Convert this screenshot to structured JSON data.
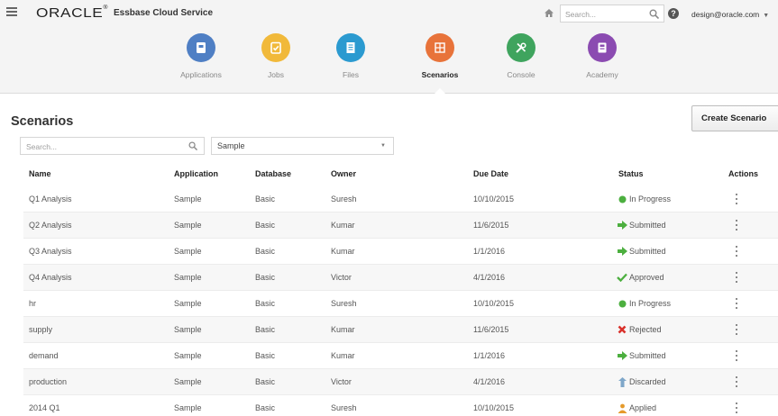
{
  "header": {
    "logo_text": "ORACLE",
    "logo_mark": "®",
    "service_title": "Essbase Cloud Service",
    "search_placeholder": "Search...",
    "user": "design@oracle.com",
    "help_label": "?"
  },
  "nav": {
    "items": [
      {
        "label": "Applications",
        "color": "#4f7fc4",
        "icon": "applications-icon"
      },
      {
        "label": "Jobs",
        "color": "#f1b93a",
        "icon": "jobs-icon"
      },
      {
        "label": "Files",
        "color": "#2b9ad0",
        "icon": "files-icon"
      },
      {
        "label": "Scenarios",
        "color": "#e8733a",
        "icon": "scenarios-icon",
        "active": true
      },
      {
        "label": "Console",
        "color": "#3fa45e",
        "icon": "console-icon"
      },
      {
        "label": "Academy",
        "color": "#8b4bb1",
        "icon": "academy-icon"
      }
    ]
  },
  "page": {
    "title": "Scenarios",
    "create_button": "Create Scenario",
    "search_placeholder": "Search...",
    "application_filter": "Sample"
  },
  "table": {
    "columns": [
      "Name",
      "Application",
      "Database",
      "Owner",
      "Due Date",
      "Status",
      "Actions"
    ],
    "rows": [
      {
        "name": "Q1 Analysis",
        "application": "Sample",
        "database": "Basic",
        "owner": "Suresh",
        "due": "10/10/2015",
        "status": "In Progress"
      },
      {
        "name": "Q2 Analysis",
        "application": "Sample",
        "database": "Basic",
        "owner": "Kumar",
        "due": "11/6/2015",
        "status": "Submitted"
      },
      {
        "name": "Q3 Analysis",
        "application": "Sample",
        "database": "Basic",
        "owner": "Kumar",
        "due": "1/1/2016",
        "status": "Submitted"
      },
      {
        "name": "Q4 Analysis",
        "application": "Sample",
        "database": "Basic",
        "owner": "Victor",
        "due": "4/1/2016",
        "status": "Approved"
      },
      {
        "name": "hr",
        "application": "Sample",
        "database": "Basic",
        "owner": "Suresh",
        "due": "10/10/2015",
        "status": "In Progress"
      },
      {
        "name": "supply",
        "application": "Sample",
        "database": "Basic",
        "owner": "Kumar",
        "due": "11/6/2015",
        "status": "Rejected"
      },
      {
        "name": "demand",
        "application": "Sample",
        "database": "Basic",
        "owner": "Kumar",
        "due": "1/1/2016",
        "status": "Submitted"
      },
      {
        "name": "production",
        "application": "Sample",
        "database": "Basic",
        "owner": "Victor",
        "due": "4/1/2016",
        "status": "Discarded"
      },
      {
        "name": "2014 Q1",
        "application": "Sample",
        "database": "Basic",
        "owner": "Suresh",
        "due": "10/10/2015",
        "status": "Applied"
      }
    ]
  },
  "status_styles": {
    "In Progress": {
      "icon": "green-dot-icon",
      "color": "#4caf3f"
    },
    "Submitted": {
      "icon": "green-arrow-icon",
      "color": "#4caf3f"
    },
    "Approved": {
      "icon": "green-check-icon",
      "color": "#4caf3f"
    },
    "Rejected": {
      "icon": "red-x-icon",
      "color": "#d9312b"
    },
    "Discarded": {
      "icon": "discard-icon",
      "color": "#7fa7c9"
    },
    "Applied": {
      "icon": "applied-icon",
      "color": "#e59a2b"
    }
  }
}
